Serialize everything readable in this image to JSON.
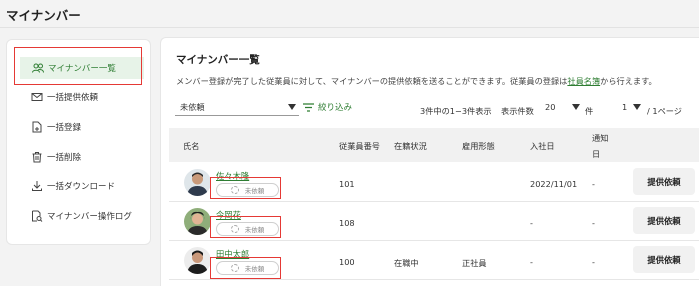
{
  "page_title": "マイナンバー",
  "sidebar": {
    "items": [
      {
        "label": "マイナンバー一覧",
        "icon": "users-icon",
        "active": true
      },
      {
        "label": "一括提供依頼",
        "icon": "mail-icon"
      },
      {
        "label": "一括登録",
        "icon": "document-add-icon"
      },
      {
        "label": "一括削除",
        "icon": "trash-icon"
      },
      {
        "label": "一括ダウンロード",
        "icon": "download-icon"
      },
      {
        "label": "マイナンバー操作ログ",
        "icon": "log-search-icon"
      }
    ]
  },
  "main": {
    "title": "マイナンバー一覧",
    "description_prefix": "メンバー登録が完了した従業員に対して、マイナンバーの提供依頼を送ることができます。従業員の登録は",
    "description_link": "社員名簿",
    "description_suffix": "から行えます。",
    "filter": {
      "selected": "未依頼",
      "filter_label": "絞り込み"
    },
    "pagination": {
      "range_text": "3件中の1−3件表示",
      "per_page_label": "表示件数",
      "per_page_value": "20",
      "per_page_unit": "件",
      "page_value": "1",
      "page_total": "/ 1ページ"
    }
  },
  "table": {
    "headers": {
      "name": "氏名",
      "emp_no": "従業員番号",
      "status": "在籍状況",
      "employment_type": "雇用形態",
      "join_date": "入社日",
      "notify_line1": "通知",
      "notify_line2": "日"
    },
    "rows": [
      {
        "name": "佐々木隆",
        "badge": "未依頼",
        "emp_no": "101",
        "status": "",
        "employment_type": "",
        "join_date": "2022/11/01",
        "notify": "-",
        "action": "提供依頼"
      },
      {
        "name": "今岡花",
        "badge": "未依頼",
        "emp_no": "108",
        "status": "",
        "employment_type": "",
        "join_date": "-",
        "notify": "-",
        "action": "提供依頼"
      },
      {
        "name": "田中太郎",
        "badge": "未依頼",
        "emp_no": "100",
        "status": "在職中",
        "employment_type": "正社員",
        "join_date": "-",
        "notify": "-",
        "action": "提供依頼"
      }
    ]
  },
  "colors": {
    "accent": "#2e7d32",
    "highlight": "#e53935",
    "active_bg": "#e7f3e8"
  }
}
